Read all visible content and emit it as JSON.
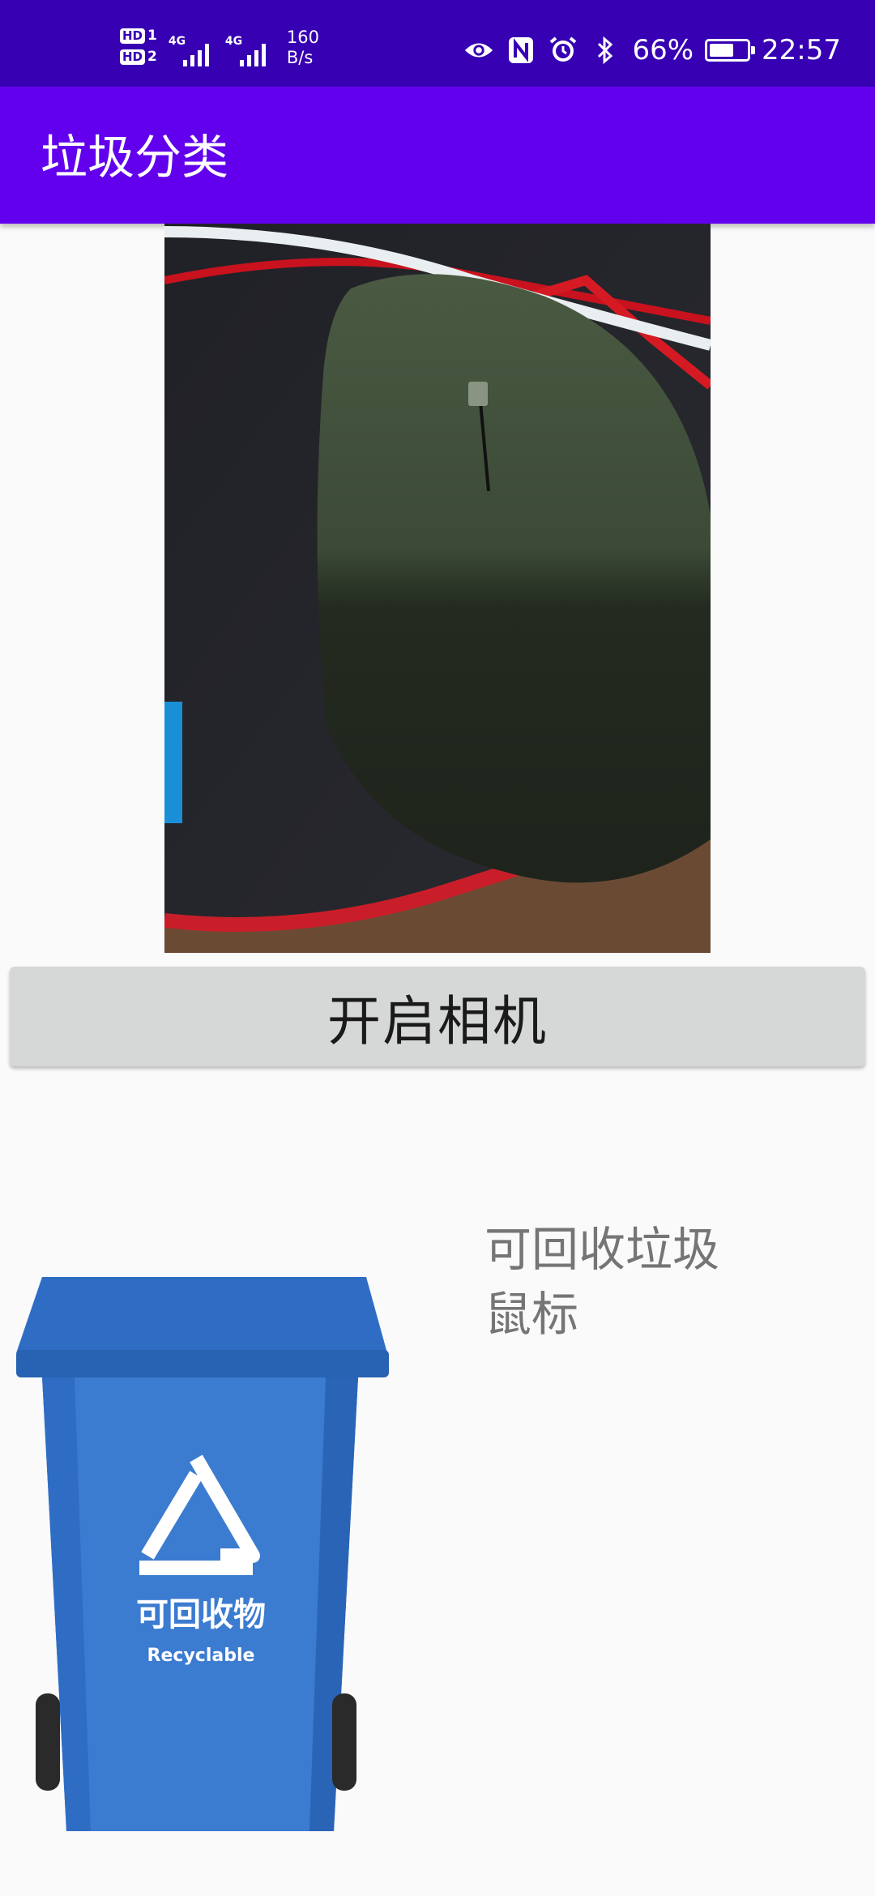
{
  "status_bar": {
    "sim1": "HD",
    "sim1_slot": "1",
    "sim2": "HD",
    "sim2_slot": "2",
    "net1": "4G",
    "net2": "4G",
    "speed_value": "160",
    "speed_unit": "B/s",
    "battery": "66%",
    "battery_level": 0.66,
    "time": "22:57",
    "icons": [
      "eye-icon",
      "nfc-icon",
      "alarm-icon",
      "bluetooth-icon",
      "battery-charging-icon"
    ]
  },
  "app_bar": {
    "title": "垃圾分类"
  },
  "main": {
    "camera_button_label": "开启相机",
    "result_category": "可回收垃圾",
    "result_item": "鼠标",
    "bin": {
      "label_cn": "可回收物",
      "label_en": "Recyclable",
      "color": "#2f6dc4"
    }
  },
  "colors": {
    "status_bar": "#3700b3",
    "app_bar": "#6200ee",
    "button": "#d6d7d7",
    "result_text": "#757575"
  }
}
